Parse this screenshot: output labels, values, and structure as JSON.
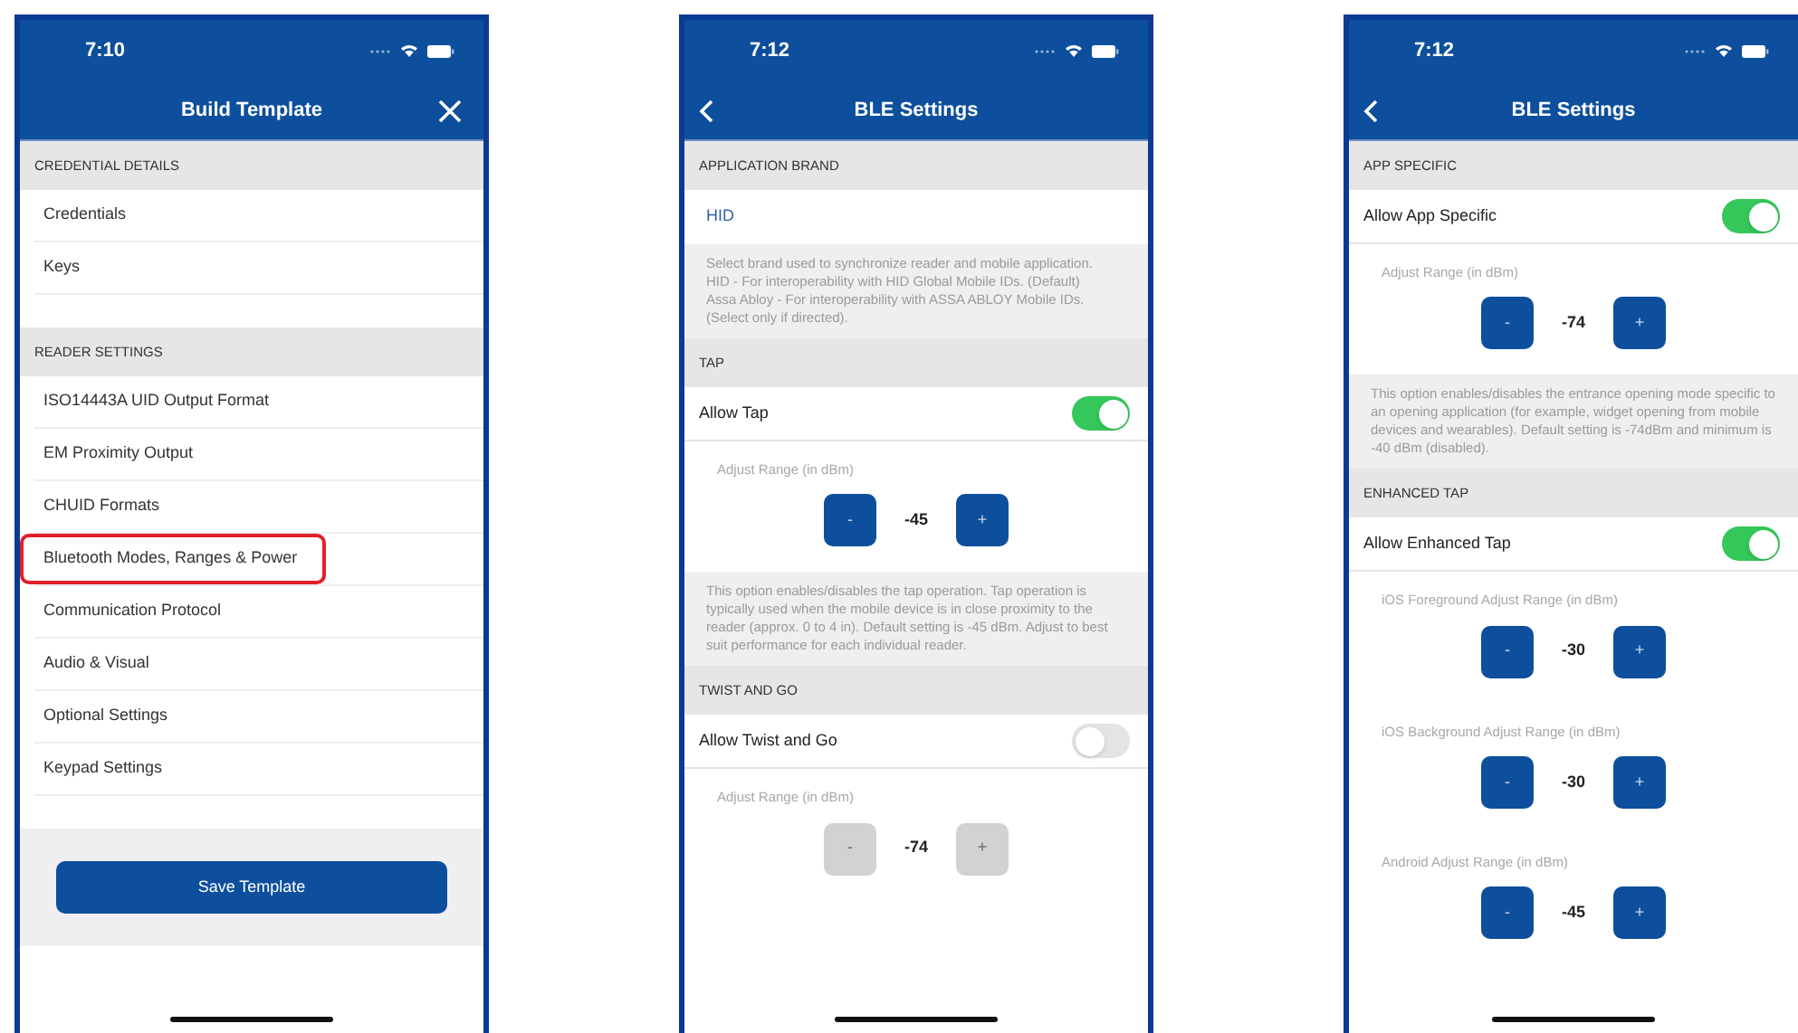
{
  "phones": [
    {
      "status_time": "7:10",
      "title": "Build Template",
      "nav_button": {
        "kind": "close"
      },
      "sections": [
        {
          "header": "CREDENTIAL DETAILS",
          "rows": [
            {
              "kind": "link",
              "label": "Credentials",
              "highlighted": false
            },
            {
              "kind": "link",
              "label": "Keys",
              "highlighted": false
            }
          ]
        },
        {
          "header": "READER SETTINGS",
          "rows": [
            {
              "kind": "link",
              "label": "ISO14443A UID Output Format",
              "highlighted": false
            },
            {
              "kind": "link",
              "label": "EM Proximity Output",
              "highlighted": false
            },
            {
              "kind": "link",
              "label": "CHUID Formats",
              "highlighted": false
            },
            {
              "kind": "link",
              "label": "Bluetooth Modes, Ranges & Power",
              "highlighted": true
            },
            {
              "kind": "link",
              "label": "Communication Protocol",
              "highlighted": false
            },
            {
              "kind": "link",
              "label": "Audio & Visual",
              "highlighted": false
            },
            {
              "kind": "link",
              "label": "Optional Settings",
              "highlighted": false
            },
            {
              "kind": "link",
              "label": "Keypad Settings",
              "highlighted": false
            }
          ]
        }
      ],
      "footer_button": "Save Template"
    },
    {
      "status_time": "7:12",
      "title": "BLE Settings",
      "nav_button": {
        "kind": "back"
      },
      "sections": [
        {
          "header": "APPLICATION BRAND",
          "rows": [
            {
              "kind": "value",
              "label": "HID"
            },
            {
              "kind": "note",
              "text": "Select brand used to synchronize reader and mobile application.\nHID - For interoperability with HID Global Mobile IDs. (Default)\nAssa Abloy - For interoperability with ASSA ABLOY Mobile IDs. (Select only if directed)."
            }
          ]
        },
        {
          "header": "TAP",
          "rows": [
            {
              "kind": "toggle",
              "label": "Allow Tap",
              "on": true
            },
            {
              "kind": "stepper",
              "label": "Adjust Range (in dBm)",
              "minus": "-",
              "value": "-45",
              "plus": "+",
              "disabled": false
            },
            {
              "kind": "note",
              "text": "This option enables/disables the tap operation. Tap operation is typically used when the mobile device is in close proximity to the reader (approx. 0 to 4 in). Default setting is -45 dBm. Adjust to best suit performance for each individual reader."
            }
          ]
        },
        {
          "header": "TWIST AND GO",
          "rows": [
            {
              "kind": "toggle",
              "label": "Allow Twist and Go",
              "on": false
            },
            {
              "kind": "stepper",
              "label": "Adjust Range (in dBm)",
              "minus": "-",
              "value": "-74",
              "plus": "+",
              "disabled": true
            }
          ]
        }
      ]
    },
    {
      "status_time": "7:12",
      "title": "BLE Settings",
      "nav_button": {
        "kind": "back"
      },
      "sections": [
        {
          "header": "APP SPECIFIC",
          "rows": [
            {
              "kind": "toggle",
              "label": "Allow App Specific",
              "on": true
            },
            {
              "kind": "stepper",
              "label": "Adjust Range (in dBm)",
              "minus": "-",
              "value": "-74",
              "plus": "+",
              "disabled": false
            },
            {
              "kind": "note",
              "text": "This option enables/disables the entrance opening mode specific to an opening application (for example, widget opening from mobile devices and wearables). Default setting is -74dBm and minimum is -40 dBm (disabled)."
            }
          ]
        },
        {
          "header": "ENHANCED TAP",
          "rows": [
            {
              "kind": "toggle",
              "label": "Allow Enhanced Tap",
              "on": true
            },
            {
              "kind": "stepper",
              "label": "iOS Foreground Adjust Range (in dBm)",
              "minus": "-",
              "value": "-30",
              "plus": "+",
              "disabled": false
            },
            {
              "kind": "stepper",
              "label": "iOS Background Adjust Range (in dBm)",
              "minus": "-",
              "value": "-30",
              "plus": "+",
              "disabled": false
            },
            {
              "kind": "stepper",
              "label": "Android Adjust Range (in dBm)",
              "minus": "-",
              "value": "-45",
              "plus": "+",
              "disabled": false
            }
          ]
        }
      ]
    }
  ]
}
